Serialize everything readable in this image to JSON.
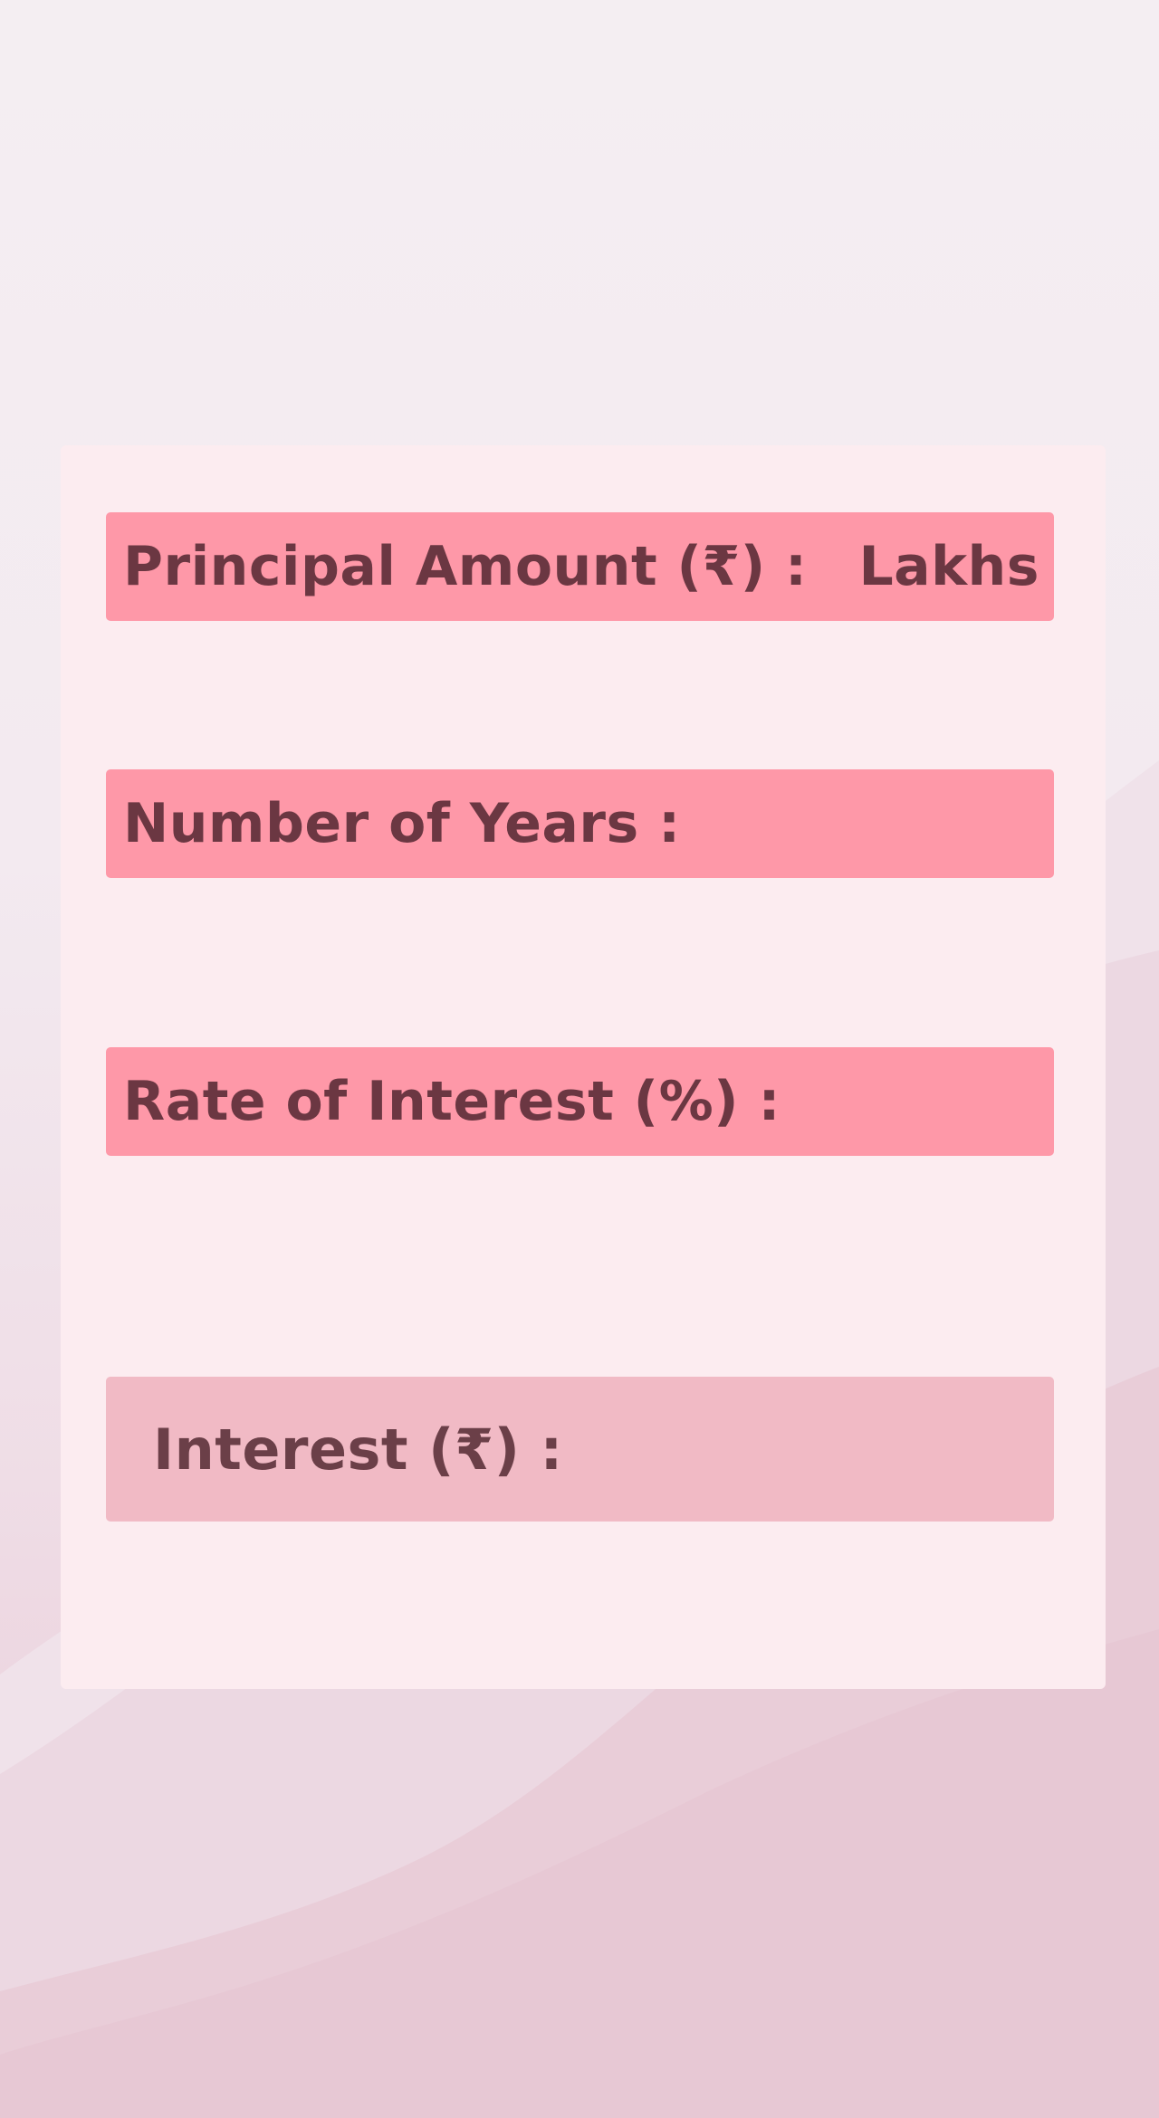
{
  "form": {
    "principal": {
      "label": "Principal Amount (₹) :",
      "unit": "Lakhs",
      "value": ""
    },
    "years": {
      "label": "Number of Years :",
      "value": ""
    },
    "rate": {
      "label": "Rate of Interest (%) :",
      "value": ""
    }
  },
  "result": {
    "label": "Interest (₹) :",
    "value": ""
  },
  "colors": {
    "field_bg": "#fe98a8",
    "result_bg": "#f1bac5",
    "card_bg": "#fcecf0",
    "text": "#6b3742"
  }
}
